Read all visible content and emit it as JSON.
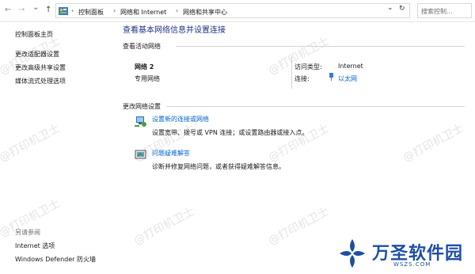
{
  "address_bar": {
    "back": "←",
    "forward": "→",
    "recent": "⌄",
    "up": "↑",
    "crumbs": [
      "控制面板",
      "网络和 Internet",
      "网络和共享中心"
    ],
    "separator": "›",
    "dropdown": "⌄",
    "refresh": "↻",
    "search_placeholder": "搜索控制..."
  },
  "sidebar": {
    "items": [
      "控制面板主页",
      "更改适配器设置",
      "更改高级共享设置",
      "媒体流式处理选项"
    ],
    "see_also_label": "另请参阅",
    "see_also_items": [
      "Internet 选项",
      "Windows Defender 防火墙"
    ]
  },
  "main": {
    "title": "查看基本网络信息并设置连接",
    "active_networks_label": "查看活动网络",
    "network": {
      "name": "网络 2",
      "type": "专用网络",
      "access_type_label": "访问类型:",
      "access_type_value": "Internet",
      "connections_label": "连接:",
      "connection_value": "以太网"
    },
    "change_settings_label": "更改网络设置",
    "actions": [
      {
        "title": "设置新的连接或网络",
        "desc": "设置宽带、拨号或 VPN 连接；或设置路由器或接入点。"
      },
      {
        "title": "问题疑难解答",
        "desc": "诊断并修复网络问题，或者获得疑难解答信息。"
      }
    ]
  },
  "watermark": {
    "text": "@打印机卫士"
  },
  "logo": {
    "title": "万圣软件园",
    "subtitle": "WSZS.COM"
  },
  "colors": {
    "link": "#0066cc",
    "title": "#1e3287",
    "logo": "#1f4fa3"
  }
}
